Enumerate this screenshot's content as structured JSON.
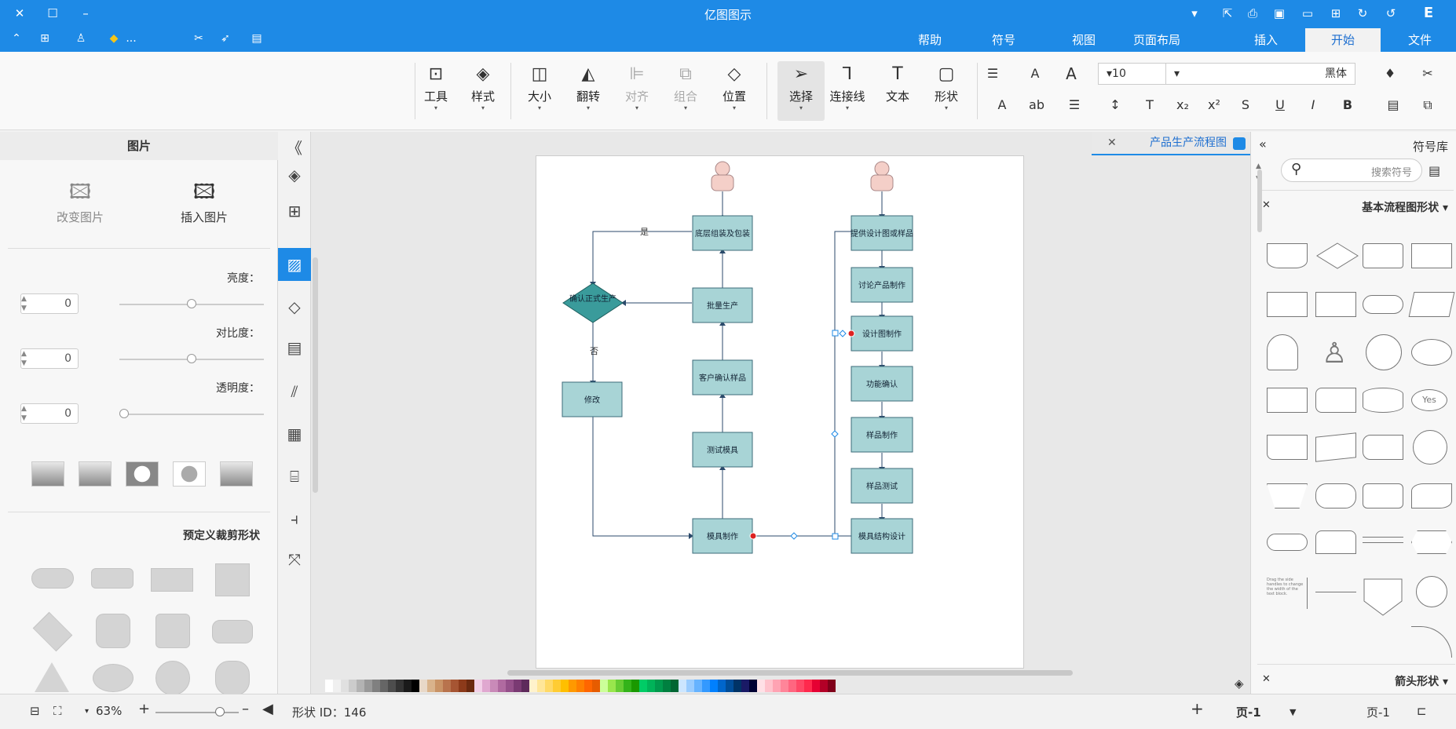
{
  "window": {
    "title": "亿图图示",
    "close": "✕",
    "maximize": "☐",
    "minimize": "–"
  },
  "quick_access": {
    "more": "..."
  },
  "tabs": [
    "帮助",
    "符号",
    "视图",
    "页面布局",
    "插入",
    "开始",
    "文件"
  ],
  "ribbon": {
    "groups": [
      {
        "label": "工具"
      },
      {
        "label": "样式"
      },
      {
        "label": "大小"
      },
      {
        "label": "翻转"
      },
      {
        "label": "对齐"
      },
      {
        "label": "组合"
      },
      {
        "label": "位置"
      },
      {
        "label": "选择"
      },
      {
        "label": "连接线"
      },
      {
        "label": "文本"
      },
      {
        "label": "形状"
      }
    ],
    "font_size": "10",
    "font_name": "黑体"
  },
  "left_panel": {
    "title": "图片",
    "insert_image": "插入图片",
    "change_image": "改变图片",
    "brightness_label": "亮度：",
    "brightness": "0",
    "brightness_level": 0.5,
    "contrast_label": "对比度：",
    "contrast": "0",
    "contrast_level": 0.5,
    "transparency_label": "透明度：",
    "transparency": "0",
    "transparency_level": 0.0,
    "crop_title": "预定义裁剪形状"
  },
  "document": {
    "tab_title": "产品生产流程图",
    "close": "✕"
  },
  "flowchart": {
    "boxes_left": [
      "底层组装及包装",
      "批量生产",
      "客户确认样品",
      "测试模具",
      "模具制作"
    ],
    "boxes_right": [
      "提供设计图或样品",
      "讨论产品制作",
      "设计图制作",
      "功能确认",
      "样品制作",
      "样品测试",
      "模具结构设计"
    ],
    "decision": "确认正式生产",
    "modify": "修改",
    "yes": "是",
    "no": "否"
  },
  "right_panel": {
    "title": "符号库",
    "search_placeholder": "搜索符号",
    "section1": "基本流程图形状",
    "section2": "箭头形状",
    "yes_shape": "Yes",
    "note_text": "Drag the side handles to change the width of the text block."
  },
  "status": {
    "page_label": "页-1",
    "page_tab": "页-1",
    "add": "+",
    "shape_id": "形状 ID：146",
    "zoom": "63%"
  },
  "colors": {
    "accent": "#1e8ae6",
    "box_fill": "#a8d4d6",
    "decision_fill": "#3a9b9b"
  }
}
